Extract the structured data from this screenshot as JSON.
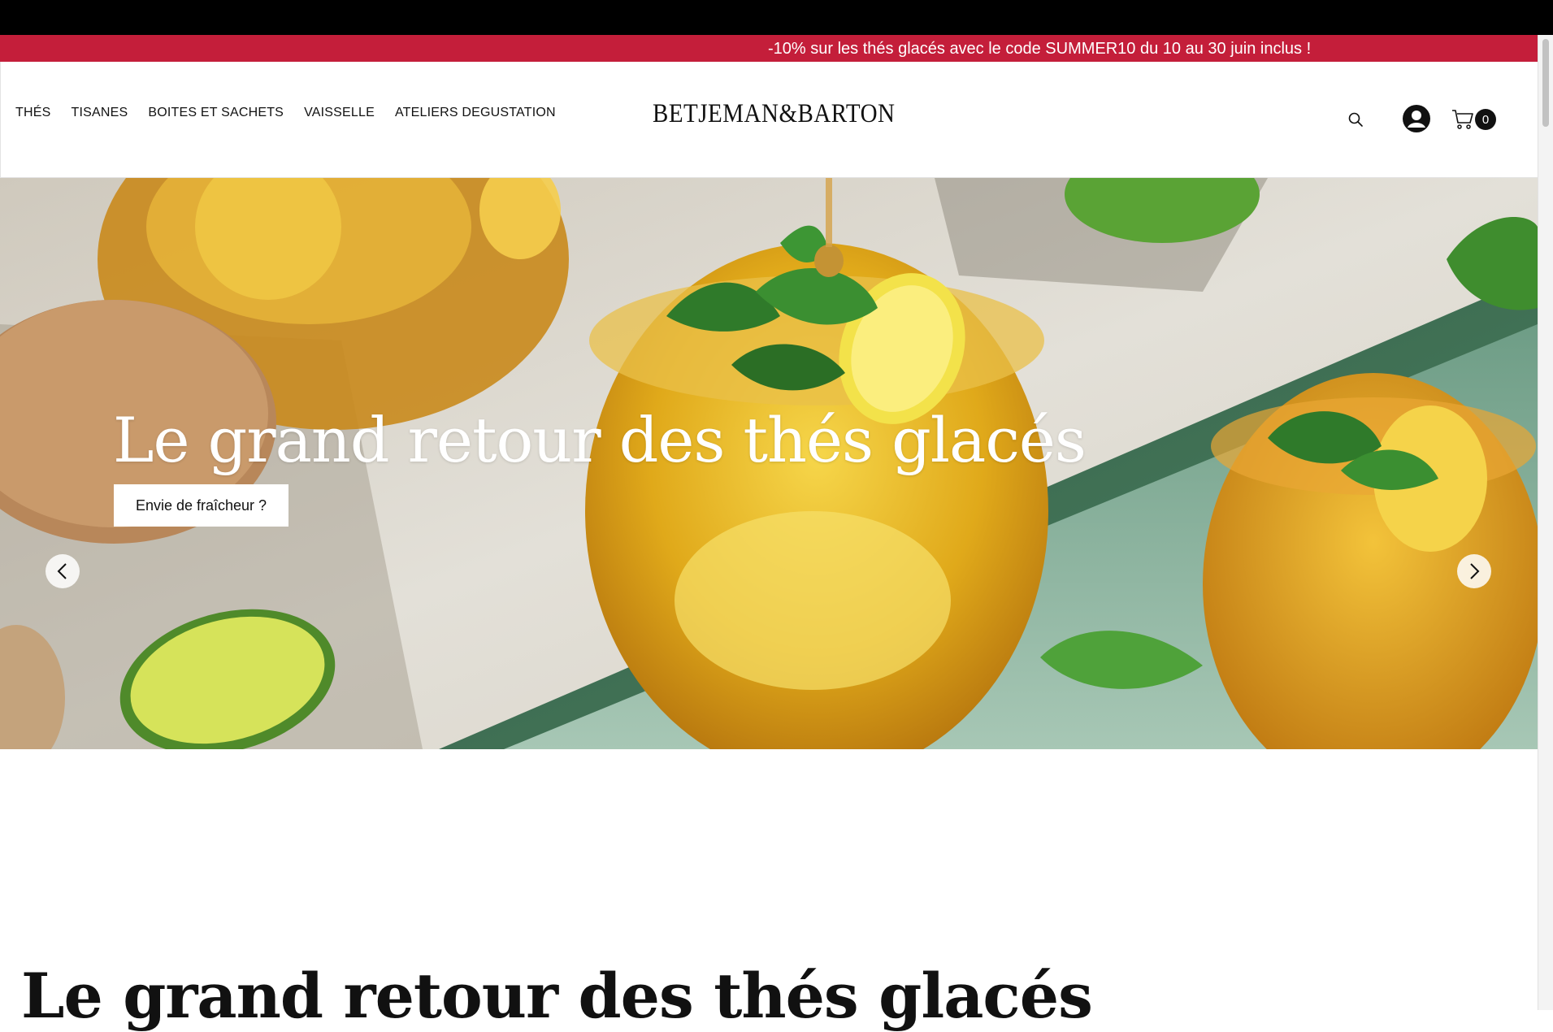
{
  "promo": {
    "text": "-10% sur les thés glacés avec le code SUMMER10 du 10 au 30 juin inclus !",
    "background": "#c41e3a"
  },
  "header": {
    "nav": [
      {
        "label": "THÉS"
      },
      {
        "label": "TISANES"
      },
      {
        "label": "BOITES ET SACHETS"
      },
      {
        "label": "VAISSELLE"
      },
      {
        "label": "ATELIERS DEGUSTATION"
      }
    ],
    "logo": "BETJEMAN&BARTON",
    "icons": {
      "search": "search-icon",
      "account": "account-icon",
      "cart": "cart-icon"
    },
    "cart_count": "0"
  },
  "hero": {
    "title": "Le grand retour des thés glacés",
    "button_label": "Envie de fraîcheur ?",
    "prev_icon": "chevron-left-icon",
    "next_icon": "chevron-right-icon"
  },
  "section": {
    "title": "Le grand retour des thés glacés"
  }
}
